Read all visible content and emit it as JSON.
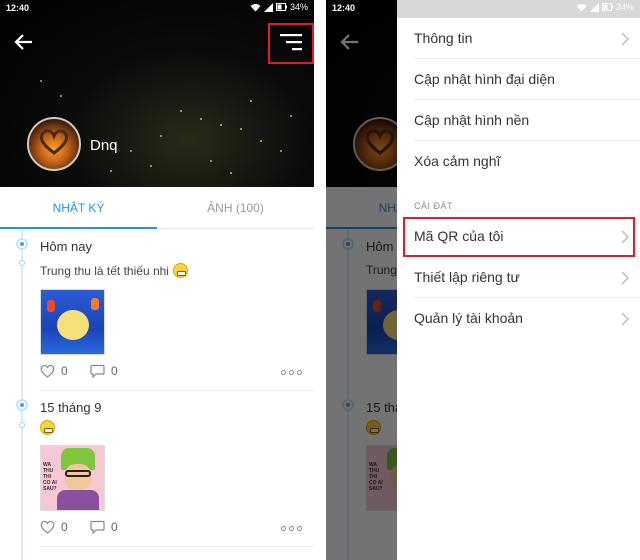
{
  "status": {
    "time": "12:40",
    "battery": "34%"
  },
  "profile": {
    "name": "Dnq"
  },
  "tabs": [
    {
      "label": "NHẬT KÝ",
      "active": true
    },
    {
      "label": "ẢNH (100)",
      "active": false
    }
  ],
  "posts": [
    {
      "date": "Hôm nay",
      "text": "Trung thu là tết thiếu nhi",
      "emoji": "grin-emoji",
      "likes": "0",
      "comments": "0"
    },
    {
      "date": "15 tháng 9",
      "text": "",
      "emoji": "grin-emoji",
      "likes": "0",
      "comments": "0",
      "image_text": "WA THU THI CO AI SAU?"
    }
  ],
  "menu": {
    "items_top": [
      "Thông tin",
      "Cập nhật hình đại diện",
      "Cập nhật hình nền",
      "Xóa cảm nghĩ"
    ],
    "section_label": "CÀI ĐẶT",
    "items_settings": [
      "Mã QR của tôi",
      "Thiết lập riêng tư",
      "Quản lý tài khoản"
    ]
  },
  "colors": {
    "accent": "#2196e6",
    "highlight": "#e11b2b"
  }
}
